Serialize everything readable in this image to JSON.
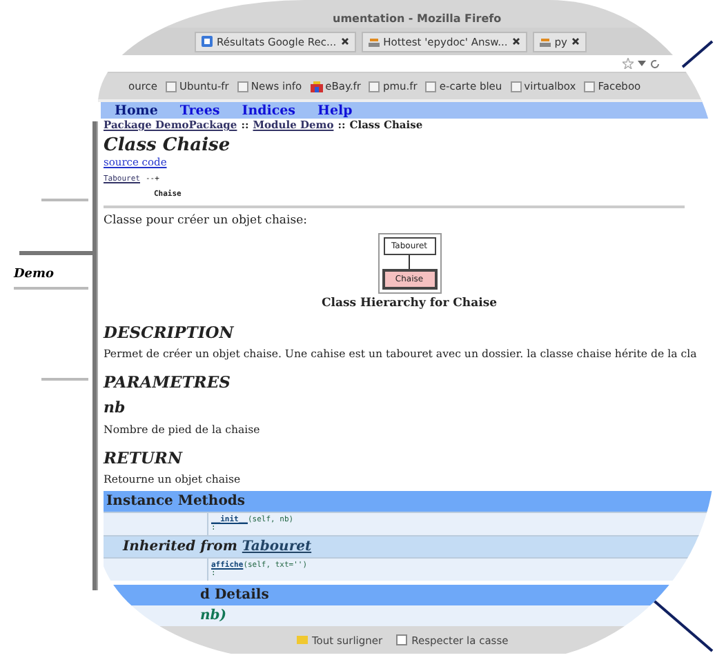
{
  "background_page": {
    "module_label": "Demo"
  },
  "window": {
    "title": "umentation - Mozilla Firefo"
  },
  "tabs": [
    {
      "label": "Résultats Google Rec...",
      "selected": false,
      "kind": "google"
    },
    {
      "label": "Hottest 'epydoc' Answ...",
      "selected": false,
      "kind": "stack"
    },
    {
      "label": "py",
      "selected": false,
      "kind": "stack"
    }
  ],
  "bookmarks": [
    {
      "label": "ource",
      "kind": "plain"
    },
    {
      "label": "Ubuntu-fr",
      "kind": "page"
    },
    {
      "label": "News info",
      "kind": "page"
    },
    {
      "label": "eBay.fr",
      "kind": "ebay"
    },
    {
      "label": "pmu.fr",
      "kind": "page"
    },
    {
      "label": "e-carte bleu",
      "kind": "page"
    },
    {
      "label": "virtualbox",
      "kind": "page"
    },
    {
      "label": "Faceboo",
      "kind": "page"
    }
  ],
  "nav": [
    "Home",
    "Trees",
    "Indices",
    "Help"
  ],
  "breadcrumb": [
    {
      "label": "Package DemoPackage",
      "kind": "link"
    },
    {
      "label": "::",
      "kind": "sep"
    },
    {
      "label": "Module Demo",
      "kind": "link"
    },
    {
      "label": "::",
      "kind": "sep"
    },
    {
      "label": "Class Chaise",
      "kind": "current"
    }
  ],
  "class_title": "Class Chaise",
  "source_link": "source code",
  "tree": {
    "parent": "Tabouret",
    "arrow": "--+",
    "child": "Chaise"
  },
  "intro": "Classe pour créer un objet chaise:",
  "diagram": {
    "parent": "Tabouret",
    "child": "Chaise",
    "caption": "Class Hierarchy for Chaise"
  },
  "blocks": [
    {
      "kind": "h2",
      "text": "DESCRIPTION"
    },
    {
      "kind": "p",
      "text": "Permet de créer un objet chaise. Une cahise est un tabouret avec un dossier. la classe chaise hérite de la cla"
    },
    {
      "kind": "h2",
      "text": "PARAMETRES"
    },
    {
      "kind": "h3",
      "text": "nb"
    },
    {
      "kind": "p",
      "text": "Nombre de pied de la chaise"
    },
    {
      "kind": "h2",
      "text": "RETURN"
    },
    {
      "kind": "p",
      "text": "Retourne un objet chaise"
    }
  ],
  "methods": {
    "title": "Instance Methods",
    "rows": [
      {
        "kind": "method",
        "name": "__init__",
        "args": "(self, nb)",
        "colon": ":"
      },
      {
        "kind": "inherited",
        "prefix": "Inherited from",
        "link": "Tabouret"
      },
      {
        "kind": "method",
        "name": "affiche",
        "args": "(self, txt='')",
        "colon": ":"
      }
    ]
  },
  "details": {
    "title": "d Details",
    "signature": "nb)"
  },
  "find_bar": [
    {
      "label": "Tout surligner",
      "kind": "button"
    },
    {
      "label": "Respecter la casse",
      "kind": "checkbox",
      "checked": false
    }
  ]
}
